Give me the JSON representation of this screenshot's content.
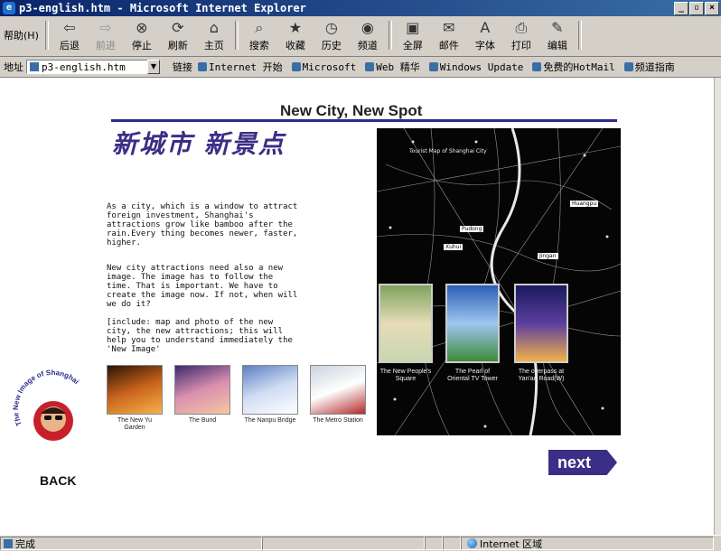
{
  "window": {
    "title": "p3-english.htm - Microsoft Internet Explorer",
    "controls": [
      "_",
      "▫",
      "×"
    ]
  },
  "toolbar": {
    "help": "帮助(H)",
    "buttons": [
      {
        "label": "后退",
        "icon": "back-arrow-icon",
        "glyph": "⇦",
        "enabled": true
      },
      {
        "label": "前进",
        "icon": "forward-arrow-icon",
        "glyph": "⇨",
        "enabled": false
      },
      {
        "label": "停止",
        "icon": "stop-icon",
        "glyph": "⊗",
        "enabled": true
      },
      {
        "label": "刷新",
        "icon": "refresh-icon",
        "glyph": "⟳",
        "enabled": true
      },
      {
        "label": "主页",
        "icon": "home-icon",
        "glyph": "⌂",
        "enabled": true
      },
      {
        "label": "搜索",
        "icon": "search-icon",
        "glyph": "⌕",
        "enabled": true
      },
      {
        "label": "收藏",
        "icon": "favorites-icon",
        "glyph": "★",
        "enabled": true
      },
      {
        "label": "历史",
        "icon": "history-icon",
        "glyph": "◷",
        "enabled": true
      },
      {
        "label": "频道",
        "icon": "channels-icon",
        "glyph": "◉",
        "enabled": true
      },
      {
        "label": "全屏",
        "icon": "fullscreen-icon",
        "glyph": "▣",
        "enabled": true
      },
      {
        "label": "邮件",
        "icon": "mail-icon",
        "glyph": "✉",
        "enabled": true
      },
      {
        "label": "字体",
        "icon": "font-icon",
        "glyph": "A",
        "enabled": true
      },
      {
        "label": "打印",
        "icon": "print-icon",
        "glyph": "⎙",
        "enabled": true
      },
      {
        "label": "编辑",
        "icon": "edit-icon",
        "glyph": "✎",
        "enabled": true
      }
    ]
  },
  "address": {
    "label": "地址",
    "value": "p3-english.htm"
  },
  "links": {
    "label": "链接",
    "items": [
      "Internet 开始",
      "Microsoft",
      "Web 精华",
      "Windows Update",
      "免费的HotMail",
      "频道指南"
    ]
  },
  "page": {
    "title": "New City,  New Spot",
    "cn_heading": "新城市  新景点",
    "paragraphs": [
      "As a city, which is a window to attract foreign investment, Shanghai's attractions grow like bamboo after the rain.Every thing becomes newer, faster, higher.",
      "New city attractions need also a new image. The image has to follow the time. That is important. We have to create the image now. If not, when will we do it?",
      "[include: map and photo of the new city, the new attractions; this will help you to understand immediately the 'New Image'"
    ],
    "thumbnails": [
      {
        "caption": "The New Yu Garden",
        "colors": [
          "#2a1305",
          "#c9631c",
          "#f4b34a"
        ]
      },
      {
        "caption": "The Bund",
        "colors": [
          "#3a2a6a",
          "#d98fb0",
          "#f4c7a0"
        ]
      },
      {
        "caption": "The Nanpu Bridge",
        "colors": [
          "#5d7fc2",
          "#cfdcf3",
          "#ffffff"
        ]
      },
      {
        "caption": "The Metro Station",
        "colors": [
          "#c8d3de",
          "#ffffff",
          "#b22a2a"
        ]
      }
    ],
    "map": {
      "header": "Tourist Map of Shanghai City",
      "labels": [
        "Pudong",
        "Huangpu",
        "Xuhui",
        "Jingan"
      ],
      "photos": [
        {
          "caption": "The New People's Square",
          "colors": [
            "#7da35f",
            "#e6dcb8",
            "#c9d6b0"
          ]
        },
        {
          "caption": "The Pearl of Oriental TV Tower",
          "colors": [
            "#2b5fb4",
            "#9fc6f0",
            "#3f8a3a"
          ]
        },
        {
          "caption": "The overpass at Yan'an Road(W)",
          "colors": [
            "#1a1a5e",
            "#5b3f9e",
            "#f2b04a"
          ]
        }
      ]
    },
    "next_label": "next",
    "back_label": "BACK",
    "logo_text": "The New Image of Shanghai"
  },
  "status": {
    "text": "完成",
    "zone": "Internet 区域"
  }
}
